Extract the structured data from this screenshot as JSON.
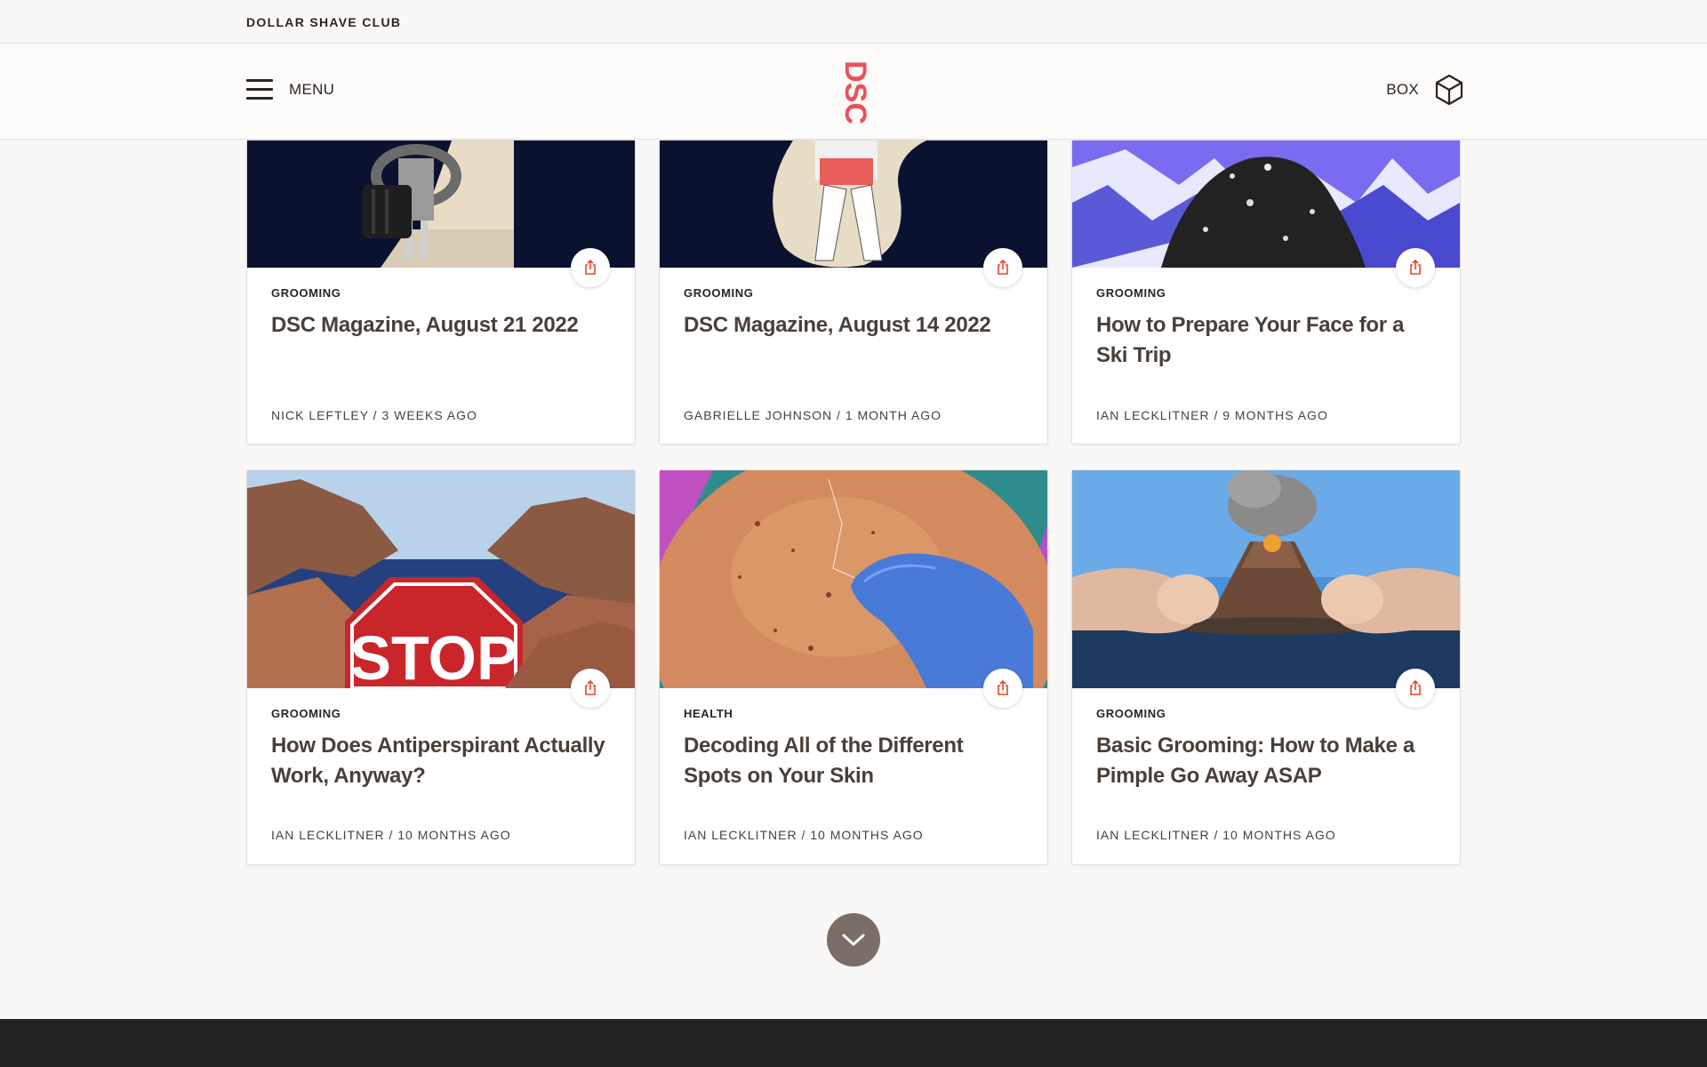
{
  "topbar": {
    "brand": "DOLLAR SHAVE CLUB"
  },
  "navbar": {
    "menu_label": "MENU",
    "logo_text": "DSC",
    "box_label": "BOX"
  },
  "articles": [
    {
      "category": "GROOMING",
      "title": "DSC Magazine, August 21 2022",
      "meta": "NICK LEFTLEY / 3 WEEKS AGO"
    },
    {
      "category": "GROOMING",
      "title": "DSC Magazine, August 14 2022",
      "meta": "GABRIELLE JOHNSON / 1 MONTH AGO"
    },
    {
      "category": "GROOMING",
      "title": "How to Prepare Your Face for a Ski Trip",
      "meta": "IAN LECKLITNER / 9 MONTHS AGO"
    },
    {
      "category": "GROOMING",
      "title": "How Does Antiperspirant Actually Work, Anyway?",
      "meta": "IAN LECKLITNER / 10 MONTHS AGO"
    },
    {
      "category": "HEALTH",
      "title": "Decoding All of the Different Spots on Your Skin",
      "meta": "IAN LECKLITNER / 10 MONTHS AGO"
    },
    {
      "category": "GROOMING",
      "title": "Basic Grooming: How to Make a Pimple Go Away ASAP",
      "meta": "IAN LECKLITNER / 10 MONTHS AGO"
    }
  ],
  "image_text": {
    "stop_sign": "STOP"
  },
  "colors": {
    "accent": "#e8462a",
    "logo": "#e8525a",
    "text": "#4a3f38",
    "footer": "#222222"
  },
  "icons": {
    "share": "share-icon",
    "box": "box-icon",
    "menu": "hamburger-icon",
    "load_more": "chevron-down-icon"
  }
}
